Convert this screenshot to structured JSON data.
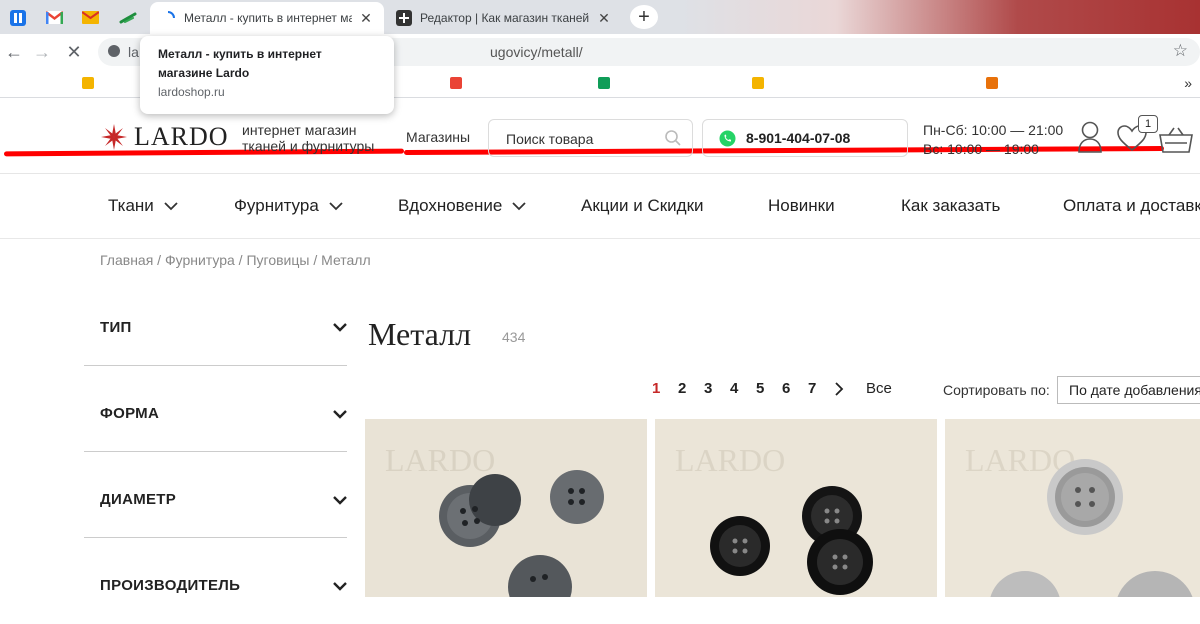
{
  "browser": {
    "tabs": [
      {
        "title": "Металл - купить в интернет магазине Lardo",
        "active": true
      },
      {
        "title": "Редактор | Как магазин тканей с",
        "active": false
      }
    ],
    "url": "la",
    "url_tail": "ugovicy/metall/",
    "tooltip": {
      "title": "Металл - купить в интернет магазине Lardo",
      "domain": "lardoshop.ru"
    }
  },
  "header": {
    "brand": "LARDO",
    "tagline": [
      "интернет магазин",
      "тканей и фурнитуры"
    ],
    "stores": "Магазины",
    "search_placeholder": "Поиск товара",
    "phone": "8-901-404-07-08",
    "hours": [
      "Пн-Сб: 10:00 — 21:00",
      "Вс: 10:00 — 19:00"
    ],
    "cart_count": "1"
  },
  "nav": [
    "Ткани",
    "Фурнитура",
    "Вдохновение",
    "Акции и Скидки",
    "Новинки",
    "Как заказать",
    "Оплата и доставка"
  ],
  "breadcrumbs": [
    "Главная",
    "Фурнитура",
    "Пуговицы",
    "Металл"
  ],
  "filters": [
    "ТИП",
    "ФОРМА",
    "ДИАМЕТР",
    "ПРОИЗВОДИТЕЛЬ"
  ],
  "catalog": {
    "title": "Металл",
    "count": "434",
    "pages": [
      "1",
      "2",
      "3",
      "4",
      "5",
      "6",
      "7"
    ],
    "current_page": "1",
    "all_label": "Все",
    "sort_label": "Сортировать по:",
    "sort_value": "По дате добавления",
    "watermark": "LARDO"
  },
  "colors": {
    "accent": "#c62828",
    "whatsapp": "#25d366"
  }
}
